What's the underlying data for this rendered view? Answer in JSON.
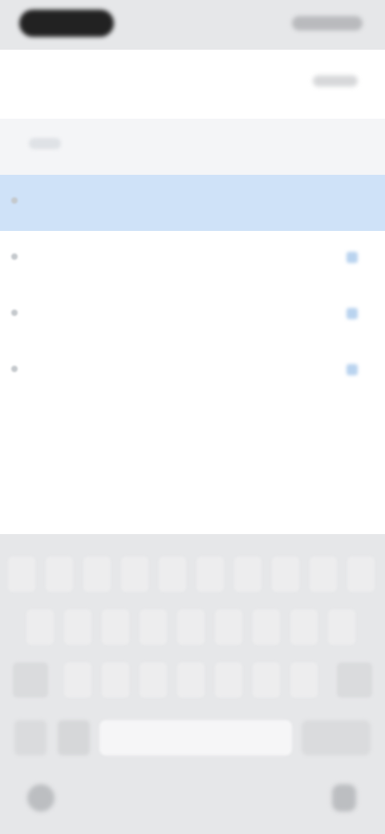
{
  "nav": {
    "title": ""
  },
  "list": {
    "rows": [
      {
        "label": "",
        "selected": true
      },
      {
        "label": ""
      },
      {
        "label": ""
      },
      {
        "label": ""
      }
    ],
    "sub_items": [
      "",
      "",
      "",
      "",
      ""
    ]
  },
  "keyboard": {
    "row1": [
      "",
      "",
      "",
      "",
      "",
      "",
      "",
      "",
      "",
      ""
    ],
    "row2": [
      "",
      "",
      "",
      "",
      "",
      "",
      "",
      "",
      ""
    ],
    "row3": [
      "",
      "",
      "",
      "",
      "",
      "",
      "",
      "",
      ""
    ]
  },
  "colors": {
    "selected_row": "#cfe2f8",
    "keyboard_bg": "#e6e7e9",
    "page_bg": "#f4f5f7"
  }
}
